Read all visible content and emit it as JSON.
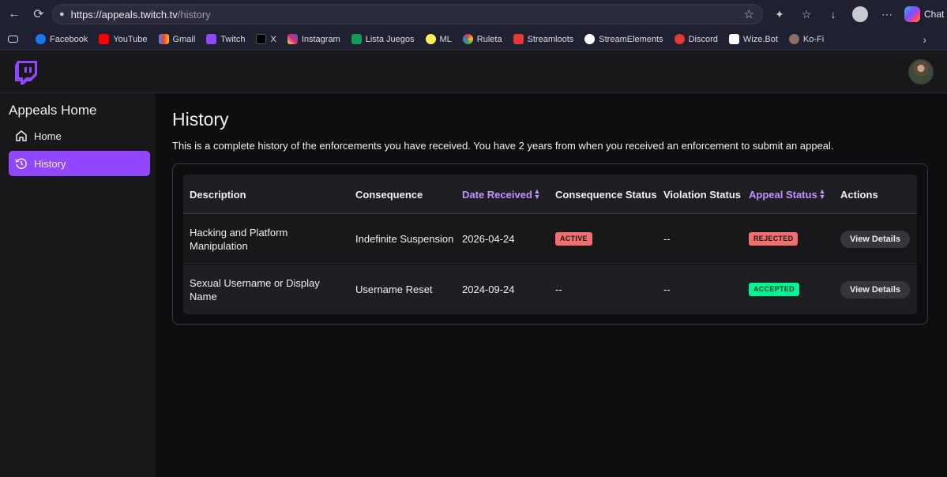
{
  "browser": {
    "url_host": "https://appeals.twitch.tv",
    "url_path": "/history",
    "chat_label": "Chat",
    "bookmarks": [
      {
        "label": "Facebook",
        "color": "#1877f2"
      },
      {
        "label": "YouTube",
        "color": "#ff0000"
      },
      {
        "label": "Gmail",
        "color": "#ea4335"
      },
      {
        "label": "Twitch",
        "color": "#9146ff"
      },
      {
        "label": "X",
        "color": "#000000"
      },
      {
        "label": "Instagram",
        "color": "#e1306c"
      },
      {
        "label": "Lista Juegos",
        "color": "#0f9d58"
      },
      {
        "label": "ML",
        "color": "#fff159"
      },
      {
        "label": "Ruleta",
        "color": "#ff6f00"
      },
      {
        "label": "Streamloots",
        "color": "#e53935"
      },
      {
        "label": "StreamElements",
        "color": "#ffffff"
      },
      {
        "label": "Discord",
        "color": "#e53935"
      },
      {
        "label": "Wize.Bot",
        "color": "#ffffff"
      },
      {
        "label": "Ko-Fi",
        "color": "#8d6e63"
      }
    ]
  },
  "sidebar": {
    "title": "Appeals Home",
    "items": [
      {
        "label": "Home",
        "icon": "home-icon",
        "active": false
      },
      {
        "label": "History",
        "icon": "history-icon",
        "active": true
      }
    ]
  },
  "main": {
    "title": "History",
    "description": "This is a complete history of the enforcements you have received. You have 2 years from when you received an enforcement to submit an appeal."
  },
  "table": {
    "headers": {
      "description": "Description",
      "consequence": "Consequence",
      "date_received": "Date Received",
      "consequence_status": "Consequence Status",
      "violation_status": "Violation Status",
      "appeal_status": "Appeal Status",
      "actions": "Actions"
    },
    "rows": [
      {
        "description": "Hacking and Platform Manipulation",
        "consequence": "Indefinite Suspension",
        "date_received": "2026-04-24",
        "consequence_status": "ACTIVE",
        "violation_status": "--",
        "appeal_status": "REJECTED",
        "action_label": "View Details"
      },
      {
        "description": "Sexual Username or Display Name",
        "consequence": "Username Reset",
        "date_received": "2024-09-24",
        "consequence_status": "--",
        "violation_status": "--",
        "appeal_status": "ACCEPTED",
        "action_label": "View Details"
      }
    ]
  },
  "colors": {
    "accent": "#9147ff",
    "sort_header": "#bf94ff",
    "badge_active": "#f26f6f",
    "badge_rejected": "#f26f6f",
    "badge_accepted": "#00f593"
  }
}
